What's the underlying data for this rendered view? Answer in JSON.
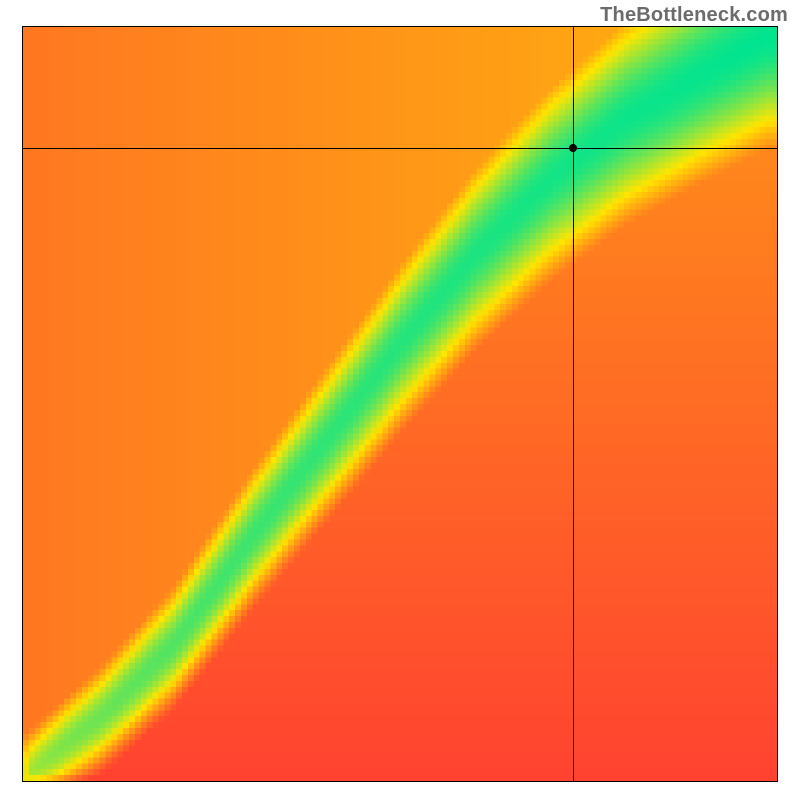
{
  "watermark": "TheBottleneck.com",
  "chart_data": {
    "type": "heatmap",
    "title": "",
    "xlabel": "",
    "ylabel": "",
    "xlim": [
      0,
      100
    ],
    "ylim": [
      0,
      100
    ],
    "grid": false,
    "legend": false,
    "marker": {
      "x": 73,
      "y": 84
    },
    "crosshair": {
      "x": 73,
      "y": 84
    },
    "description": "Heatmap: green ridge along an S-curve (optimal), fading through yellow/orange to red away from the ridge. Black crosshair and dot mark a sampled point near the ridge in the upper-right.",
    "ridge_curve": {
      "type": "s-curve",
      "points_xy": [
        [
          1,
          1
        ],
        [
          10,
          8
        ],
        [
          20,
          18
        ],
        [
          30,
          32
        ],
        [
          40,
          45
        ],
        [
          50,
          58
        ],
        [
          60,
          70
        ],
        [
          70,
          80
        ],
        [
          80,
          88
        ],
        [
          90,
          94
        ],
        [
          99,
          99
        ]
      ]
    },
    "color_scale": [
      {
        "value": 0.0,
        "color": "#ff1a3c",
        "meaning": "worst"
      },
      {
        "value": 0.5,
        "color": "#ffe500",
        "meaning": "mid"
      },
      {
        "value": 1.0,
        "color": "#00e490",
        "meaning": "best"
      }
    ],
    "resolution": 128
  }
}
